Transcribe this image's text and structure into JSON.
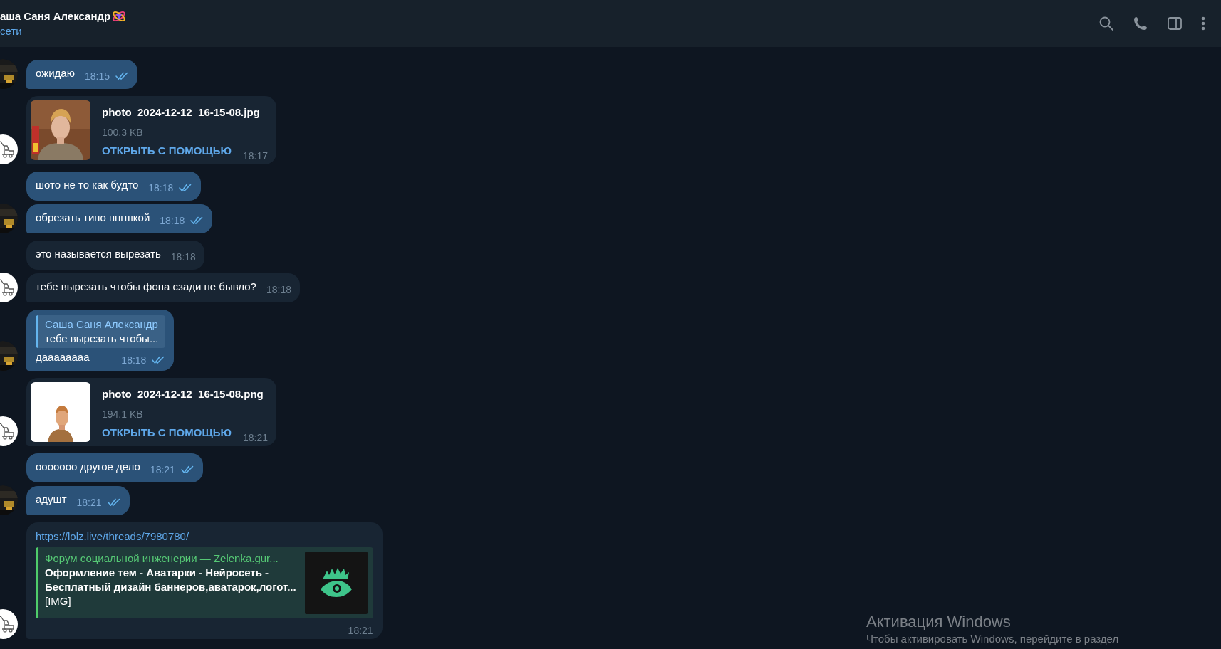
{
  "header": {
    "title": "аша Саня Александр",
    "status": "сети"
  },
  "messages": [
    {
      "kind": "text",
      "outgoing": true,
      "avatar": true,
      "text": "ожидаю",
      "time": "18:15"
    },
    {
      "kind": "file",
      "outgoing": false,
      "avatar": true,
      "filename": "photo_2024-12-12_16-15-08.jpg",
      "size": "100.3 KB",
      "action": "ОТКРЫТЬ С ПОМОЩЬЮ",
      "time": "18:17"
    },
    {
      "kind": "text",
      "outgoing": true,
      "avatar": false,
      "text": "шото не то как будто",
      "time": "18:18"
    },
    {
      "kind": "text",
      "outgoing": true,
      "avatar": true,
      "text": "обрезать типо пнгшкой",
      "time": "18:18"
    },
    {
      "kind": "text",
      "outgoing": false,
      "avatar": false,
      "text": "это называется вырезать",
      "time": "18:18"
    },
    {
      "kind": "text",
      "outgoing": false,
      "avatar": true,
      "text": "тебе вырезать чтобы фона сзади не бывло?",
      "time": "18:18"
    },
    {
      "kind": "reply",
      "outgoing": true,
      "avatar": true,
      "reply_name": "Саша Саня Александр",
      "reply_text": "тебе вырезать чтобы...",
      "text": "даааааааа",
      "time": "18:18"
    },
    {
      "kind": "file",
      "outgoing": false,
      "avatar": true,
      "filename": "photo_2024-12-12_16-15-08.png",
      "size": "194.1 KB",
      "action": "ОТКРЫТЬ С ПОМОЩЬЮ",
      "time": "18:21"
    },
    {
      "kind": "text",
      "outgoing": true,
      "avatar": false,
      "text": "ооооооо другое дело",
      "time": "18:21"
    },
    {
      "kind": "text",
      "outgoing": true,
      "avatar": true,
      "text": "адушт",
      "time": "18:21"
    },
    {
      "kind": "link",
      "outgoing": false,
      "avatar": true,
      "url": "https://lolz.live/threads/7980780/",
      "site": "Форум социальной инженерии —  Zelenka.gur...",
      "title_lines": [
        "Оформление тем - Аватарки - Нейросеть -",
        "Бесплатный дизайн баннеров,аватарок,логот..."
      ],
      "description": "[IMG]",
      "time": "18:21"
    }
  ],
  "os_notice": {
    "title": "Активация Windows",
    "text": "Чтобы активировать Windows, перейдите в раздел"
  }
}
